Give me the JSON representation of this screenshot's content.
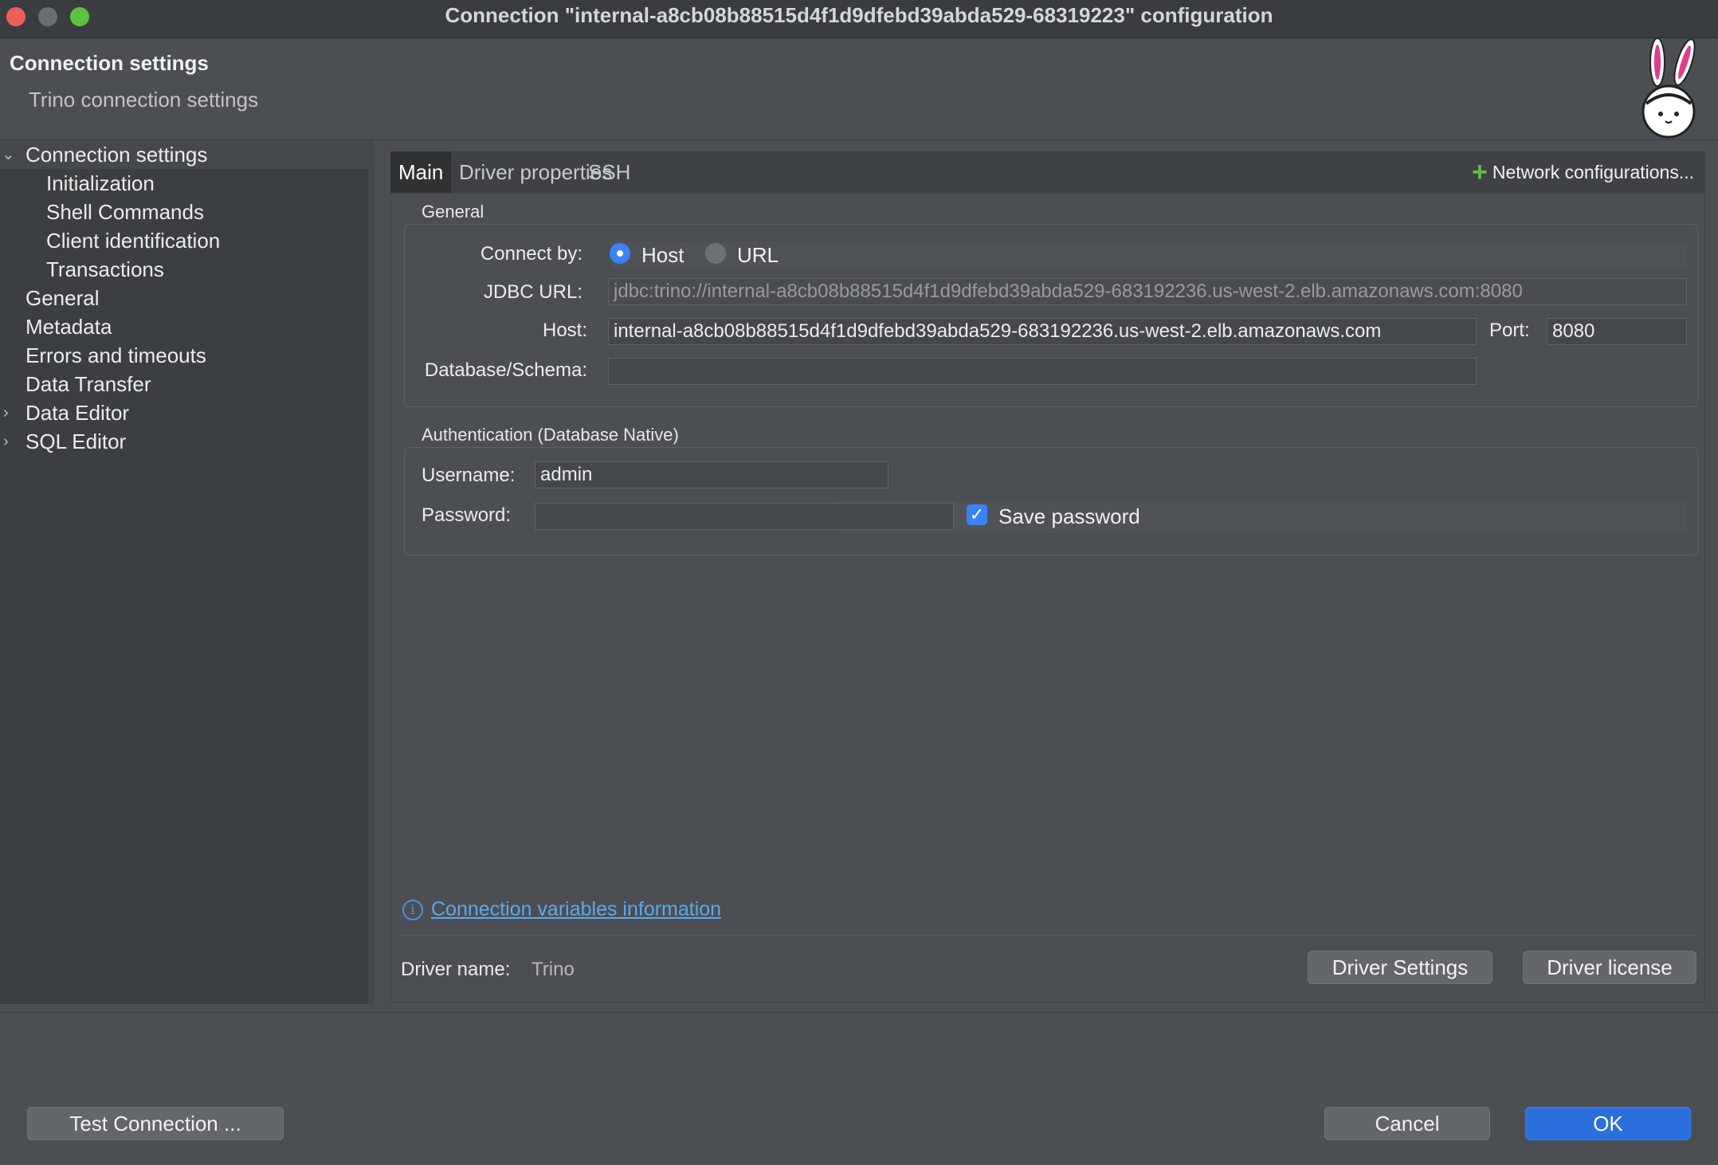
{
  "window": {
    "title": "Connection \"internal-a8cb08b88515d4f1d9dfebd39abda529-68319223\" configuration"
  },
  "header": {
    "title": "Connection settings",
    "subtitle": "Trino connection settings"
  },
  "sidebar": {
    "items": [
      {
        "label": "Connection settings",
        "expanded": true
      },
      {
        "label": "Initialization"
      },
      {
        "label": "Shell Commands"
      },
      {
        "label": "Client identification"
      },
      {
        "label": "Transactions"
      },
      {
        "label": "General"
      },
      {
        "label": "Metadata"
      },
      {
        "label": "Errors and timeouts"
      },
      {
        "label": "Data Transfer"
      },
      {
        "label": "Data Editor",
        "expandable": true
      },
      {
        "label": "SQL Editor",
        "expandable": true
      }
    ]
  },
  "tabs": [
    {
      "label": "Main",
      "active": true
    },
    {
      "label": "Driver properties"
    },
    {
      "label": "SSH"
    }
  ],
  "network_config_label": "Network configurations...",
  "general": {
    "group_label": "General",
    "connect_by_label": "Connect by:",
    "connect_by_options": [
      "Host",
      "URL"
    ],
    "connect_by_selected": "Host",
    "jdbc_label": "JDBC URL:",
    "jdbc_value": "jdbc:trino://internal-a8cb08b88515d4f1d9dfebd39abda529-683192236.us-west-2.elb.amazonaws.com:8080",
    "host_label": "Host:",
    "host_value": "internal-a8cb08b88515d4f1d9dfebd39abda529-683192236.us-west-2.elb.amazonaws.com",
    "port_label": "Port:",
    "port_value": "8080",
    "database_label": "Database/Schema:",
    "database_value": ""
  },
  "auth": {
    "group_label": "Authentication (Database Native)",
    "username_label": "Username:",
    "username_value": "admin",
    "password_label": "Password:",
    "password_value": "",
    "save_password_label": "Save password",
    "save_password_checked": true
  },
  "info_link": "Connection variables information",
  "driver": {
    "name_label": "Driver name:",
    "name_value": "Trino",
    "settings_button": "Driver Settings",
    "license_button": "Driver license"
  },
  "footer": {
    "test_button": "Test Connection ...",
    "cancel_button": "Cancel",
    "ok_button": "OK"
  },
  "colors": {
    "accent": "#3b82f6",
    "link": "#5aa9ec",
    "add_green": "#5fbf3c"
  }
}
